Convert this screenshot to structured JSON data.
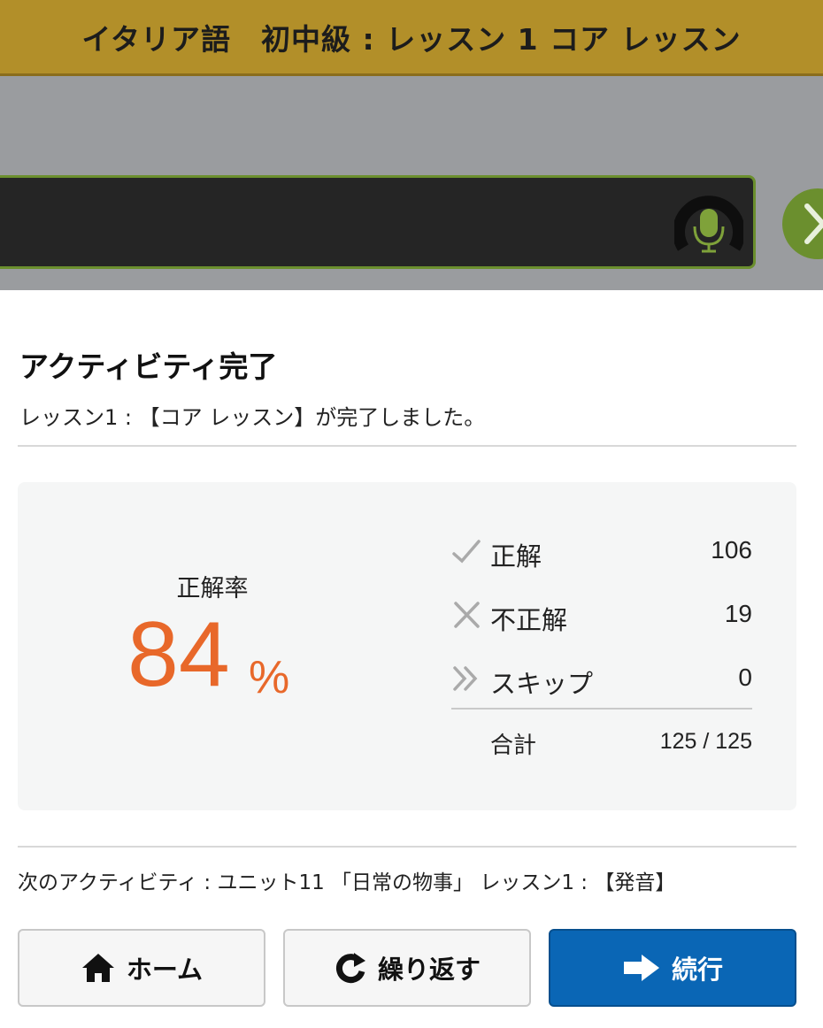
{
  "header": {
    "title": "イタリア語　初中級 : レッスン 1 コア レッスン"
  },
  "completion": {
    "title": "アクティビティ完了",
    "subtitle": "レッスン1 : 【コア レッスン】が完了しました。"
  },
  "stats": {
    "rate_label": "正解率",
    "rate_value": "84",
    "rate_unit": "%",
    "rows": [
      {
        "icon": "check-icon",
        "label": "正解",
        "value": "106"
      },
      {
        "icon": "cross-icon",
        "label": "不正解",
        "value": "19"
      },
      {
        "icon": "double-chevron-icon",
        "label": "スキップ",
        "value": "0"
      }
    ],
    "total_label": "合計",
    "total_value": "125 / 125"
  },
  "next_activity": "次のアクティビティ : ユニット11 「日常の物事」 レッスン1 : 【発音】",
  "buttons": {
    "home": "ホーム",
    "repeat": "繰り返す",
    "continue": "続行"
  },
  "colors": {
    "header_bg": "#b28f29",
    "accent_green": "#6b8f2e",
    "rate_orange": "#e8682a",
    "continue_blue": "#0a66b5"
  }
}
